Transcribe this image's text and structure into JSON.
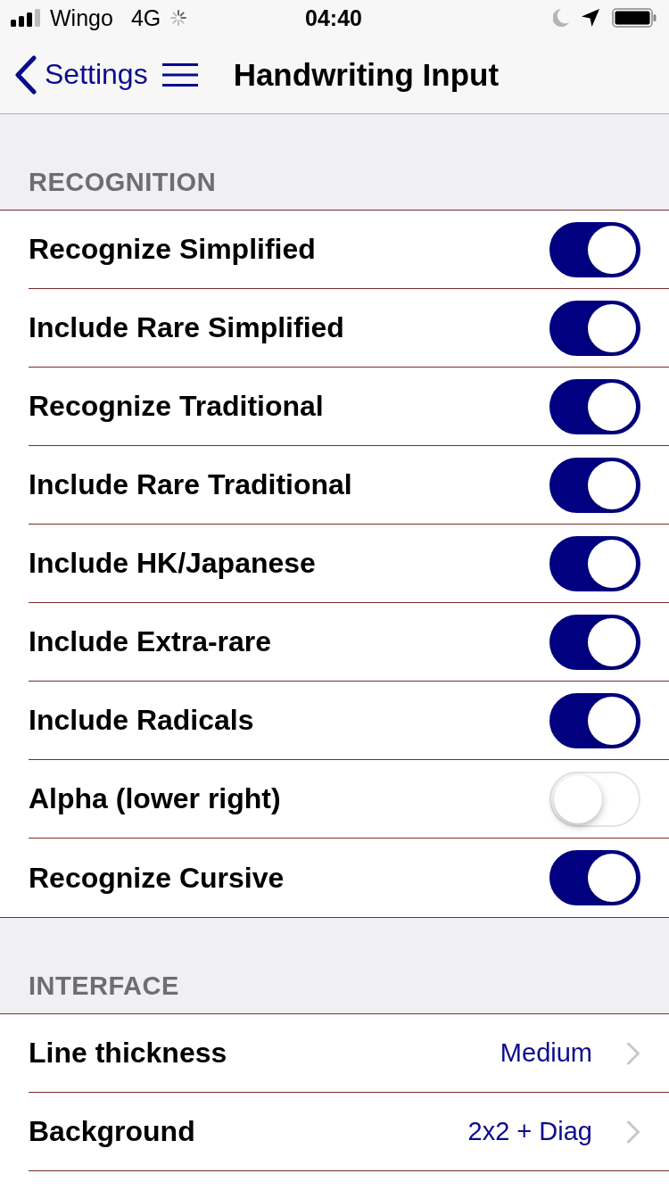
{
  "status_bar": {
    "carrier": "Wingo",
    "network": "4G",
    "time": "04:40"
  },
  "nav_bar": {
    "back_label": "Settings",
    "title": "Handwriting Input"
  },
  "sections": [
    {
      "header": "RECOGNITION",
      "rows": [
        {
          "kind": "toggle",
          "label": "Recognize Simplified",
          "on": true
        },
        {
          "kind": "toggle",
          "label": "Include Rare Simplified",
          "on": true
        },
        {
          "kind": "toggle",
          "label": "Recognize Traditional",
          "on": true
        },
        {
          "kind": "toggle",
          "label": "Include Rare Traditional",
          "on": true
        },
        {
          "kind": "toggle",
          "label": "Include HK/Japanese",
          "on": true
        },
        {
          "kind": "toggle",
          "label": "Include Extra-rare",
          "on": true
        },
        {
          "kind": "toggle",
          "label": "Include Radicals",
          "on": true
        },
        {
          "kind": "toggle",
          "label": "Alpha (lower right)",
          "on": false
        },
        {
          "kind": "toggle",
          "label": "Recognize Cursive",
          "on": true
        }
      ]
    },
    {
      "header": "INTERFACE",
      "rows": [
        {
          "kind": "disclosure",
          "label": "Line thickness",
          "value": "Medium"
        },
        {
          "kind": "disclosure",
          "label": "Background",
          "value": "2x2 + Diag"
        }
      ]
    }
  ]
}
